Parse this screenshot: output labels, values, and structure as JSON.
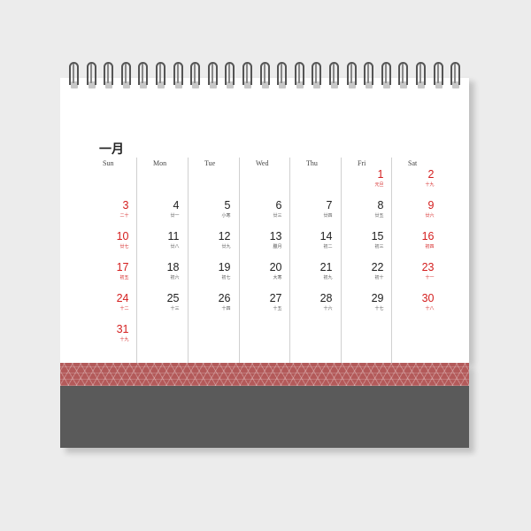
{
  "month": "一月",
  "weekdays": [
    "Sun",
    "Mon",
    "Tue",
    "Wed",
    "Thu",
    "Fri",
    "Sat"
  ],
  "colors": {
    "holiday": "#d41e1e",
    "stand": "#5a5a5a",
    "band": "#b35a5a"
  },
  "days": [
    {
      "d": "1",
      "sub": "元旦",
      "red": true,
      "col": 5,
      "row": 0
    },
    {
      "d": "2",
      "sub": "十九",
      "red": true,
      "col": 6,
      "row": 0
    },
    {
      "d": "3",
      "sub": "二十",
      "red": true,
      "col": 0,
      "row": 1
    },
    {
      "d": "4",
      "sub": "廿一",
      "red": false,
      "col": 1,
      "row": 1
    },
    {
      "d": "5",
      "sub": "小寒",
      "red": false,
      "col": 2,
      "row": 1
    },
    {
      "d": "6",
      "sub": "廿三",
      "red": false,
      "col": 3,
      "row": 1
    },
    {
      "d": "7",
      "sub": "廿四",
      "red": false,
      "col": 4,
      "row": 1
    },
    {
      "d": "8",
      "sub": "廿五",
      "red": false,
      "col": 5,
      "row": 1
    },
    {
      "d": "9",
      "sub": "廿六",
      "red": true,
      "col": 6,
      "row": 1
    },
    {
      "d": "10",
      "sub": "廿七",
      "red": true,
      "col": 0,
      "row": 2
    },
    {
      "d": "11",
      "sub": "廿八",
      "red": false,
      "col": 1,
      "row": 2
    },
    {
      "d": "12",
      "sub": "廿九",
      "red": false,
      "col": 2,
      "row": 2
    },
    {
      "d": "13",
      "sub": "臘月",
      "red": false,
      "col": 3,
      "row": 2
    },
    {
      "d": "14",
      "sub": "初二",
      "red": false,
      "col": 4,
      "row": 2
    },
    {
      "d": "15",
      "sub": "初三",
      "red": false,
      "col": 5,
      "row": 2
    },
    {
      "d": "16",
      "sub": "初四",
      "red": true,
      "col": 6,
      "row": 2
    },
    {
      "d": "17",
      "sub": "初五",
      "red": true,
      "col": 0,
      "row": 3
    },
    {
      "d": "18",
      "sub": "初六",
      "red": false,
      "col": 1,
      "row": 3
    },
    {
      "d": "19",
      "sub": "初七",
      "red": false,
      "col": 2,
      "row": 3
    },
    {
      "d": "20",
      "sub": "大寒",
      "red": false,
      "col": 3,
      "row": 3
    },
    {
      "d": "21",
      "sub": "初九",
      "red": false,
      "col": 4,
      "row": 3
    },
    {
      "d": "22",
      "sub": "初十",
      "red": false,
      "col": 5,
      "row": 3
    },
    {
      "d": "23",
      "sub": "十一",
      "red": true,
      "col": 6,
      "row": 3
    },
    {
      "d": "24",
      "sub": "十二",
      "red": true,
      "col": 0,
      "row": 4
    },
    {
      "d": "25",
      "sub": "十三",
      "red": false,
      "col": 1,
      "row": 4
    },
    {
      "d": "26",
      "sub": "十四",
      "red": false,
      "col": 2,
      "row": 4
    },
    {
      "d": "27",
      "sub": "十五",
      "red": false,
      "col": 3,
      "row": 4
    },
    {
      "d": "28",
      "sub": "十六",
      "red": false,
      "col": 4,
      "row": 4
    },
    {
      "d": "29",
      "sub": "十七",
      "red": false,
      "col": 5,
      "row": 4
    },
    {
      "d": "30",
      "sub": "十八",
      "red": true,
      "col": 6,
      "row": 4
    },
    {
      "d": "31",
      "sub": "十九",
      "red": true,
      "col": 0,
      "row": 5
    }
  ]
}
